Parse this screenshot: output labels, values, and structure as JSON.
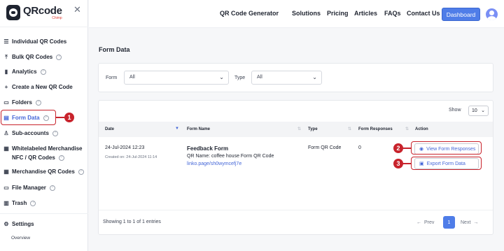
{
  "brand": {
    "name": "QRcode",
    "sub": "Chimp"
  },
  "sidebar": {
    "close_icon": "close-icon",
    "items": [
      {
        "label": "Individual QR Codes",
        "icon": "stack-icon",
        "help": false
      },
      {
        "label": "Bulk QR Codes",
        "icon": "upload-icon",
        "help": true
      },
      {
        "label": "Analytics",
        "icon": "bar-chart-icon",
        "help": true
      },
      {
        "label": "Create a New QR Code",
        "icon": "plus-icon",
        "help": false
      },
      {
        "label": "Folders",
        "icon": "folder-icon",
        "help": true
      },
      {
        "label": "Form Data",
        "icon": "form-icon",
        "help": true,
        "active": true
      },
      {
        "label": "Sub-accounts",
        "icon": "user-icon",
        "help": true
      },
      {
        "label": "Whitelabeled Merchandise",
        "label2": "NFC / QR Codes",
        "icon": "tag-icon",
        "help": true
      },
      {
        "label": "Merchandise QR Codes",
        "icon": "grid-icon",
        "help": true
      },
      {
        "label": "File Manager",
        "icon": "file-icon",
        "help": true
      },
      {
        "label": "Trash",
        "icon": "trash-icon",
        "help": true
      }
    ],
    "settings_label": "Settings",
    "settings_sub": "Overview"
  },
  "topnav": {
    "links": [
      "QR Code Generator",
      "Solutions",
      "Pricing",
      "Articles",
      "FAQs",
      "Contact Us"
    ],
    "dashboard_label": "Dashboard"
  },
  "page_title": "Form Data",
  "filters": {
    "form_label": "Form",
    "form_value": "All",
    "type_label": "Type",
    "type_value": "All"
  },
  "table": {
    "show_label": "Show",
    "show_value": "10",
    "columns": [
      "Date",
      "Form Name",
      "Type",
      "Form Responses",
      "Action"
    ],
    "rows": [
      {
        "date": "24-Jul-2024 12:23",
        "created": "Created on: 24-Jul-2024 11:14",
        "form_name": "Feedback Form",
        "qr_name": "QR Name: coffee house Form QR Code",
        "link": "linko.page/sh0wymcefj7e",
        "type": "Form QR Code",
        "responses": "0",
        "actions": [
          "View Form Responses",
          "Export Form Data"
        ]
      }
    ],
    "entries_text": "Showing 1 to 1 of 1 entries",
    "prev_label": "Prev",
    "next_label": "Next",
    "current_page": "1"
  },
  "annotations": [
    "1",
    "2",
    "3"
  ],
  "colors": {
    "accent": "#4f7de8",
    "highlight": "#c8232c",
    "link": "#4466d8"
  }
}
